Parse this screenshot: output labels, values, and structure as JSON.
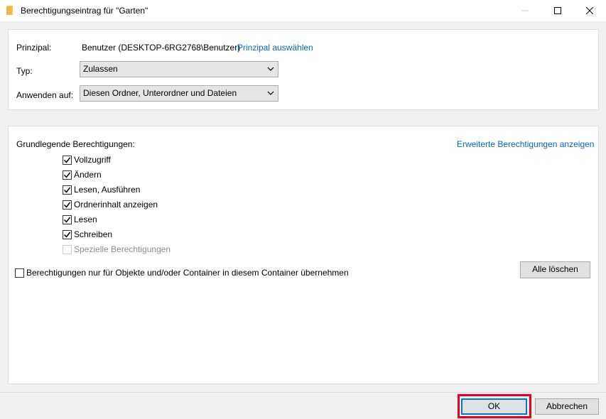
{
  "window": {
    "title": "Berechtigungseintrag für \"Garten\"",
    "icon": "folder-icon"
  },
  "principal": {
    "label": "Prinzipal:",
    "value": "Benutzer (DESKTOP-6RG2768\\Benutzer)",
    "select_link": "Prinzipal auswählen"
  },
  "type": {
    "label": "Typ:",
    "selected": "Zulassen"
  },
  "apply_to": {
    "label": "Anwenden auf:",
    "selected": "Diesen Ordner, Unterordner und Dateien"
  },
  "permissions": {
    "heading": "Grundlegende Berechtigungen:",
    "advanced_link": "Erweiterte Berechtigungen anzeigen",
    "items": [
      {
        "label": "Vollzugriff",
        "checked": true,
        "enabled": true
      },
      {
        "label": "Ändern",
        "checked": true,
        "enabled": true
      },
      {
        "label": "Lesen, Ausführen",
        "checked": true,
        "enabled": true
      },
      {
        "label": "Ordnerinhalt anzeigen",
        "checked": true,
        "enabled": true
      },
      {
        "label": "Lesen",
        "checked": true,
        "enabled": true
      },
      {
        "label": "Schreiben",
        "checked": true,
        "enabled": true
      },
      {
        "label": "Spezielle Berechtigungen",
        "checked": false,
        "enabled": false
      }
    ],
    "inherit_checkbox": {
      "label": "Berechtigungen nur für Objekte und/oder Container in diesem Container übernehmen",
      "checked": false
    },
    "clear_all_button": "Alle löschen"
  },
  "footer": {
    "ok_button": "OK",
    "cancel_button": "Abbrechen"
  },
  "colors": {
    "link": "#0066cc",
    "highlight": "#e8001c",
    "focus_border": "#0078d7",
    "folder": "#e8b94a"
  }
}
